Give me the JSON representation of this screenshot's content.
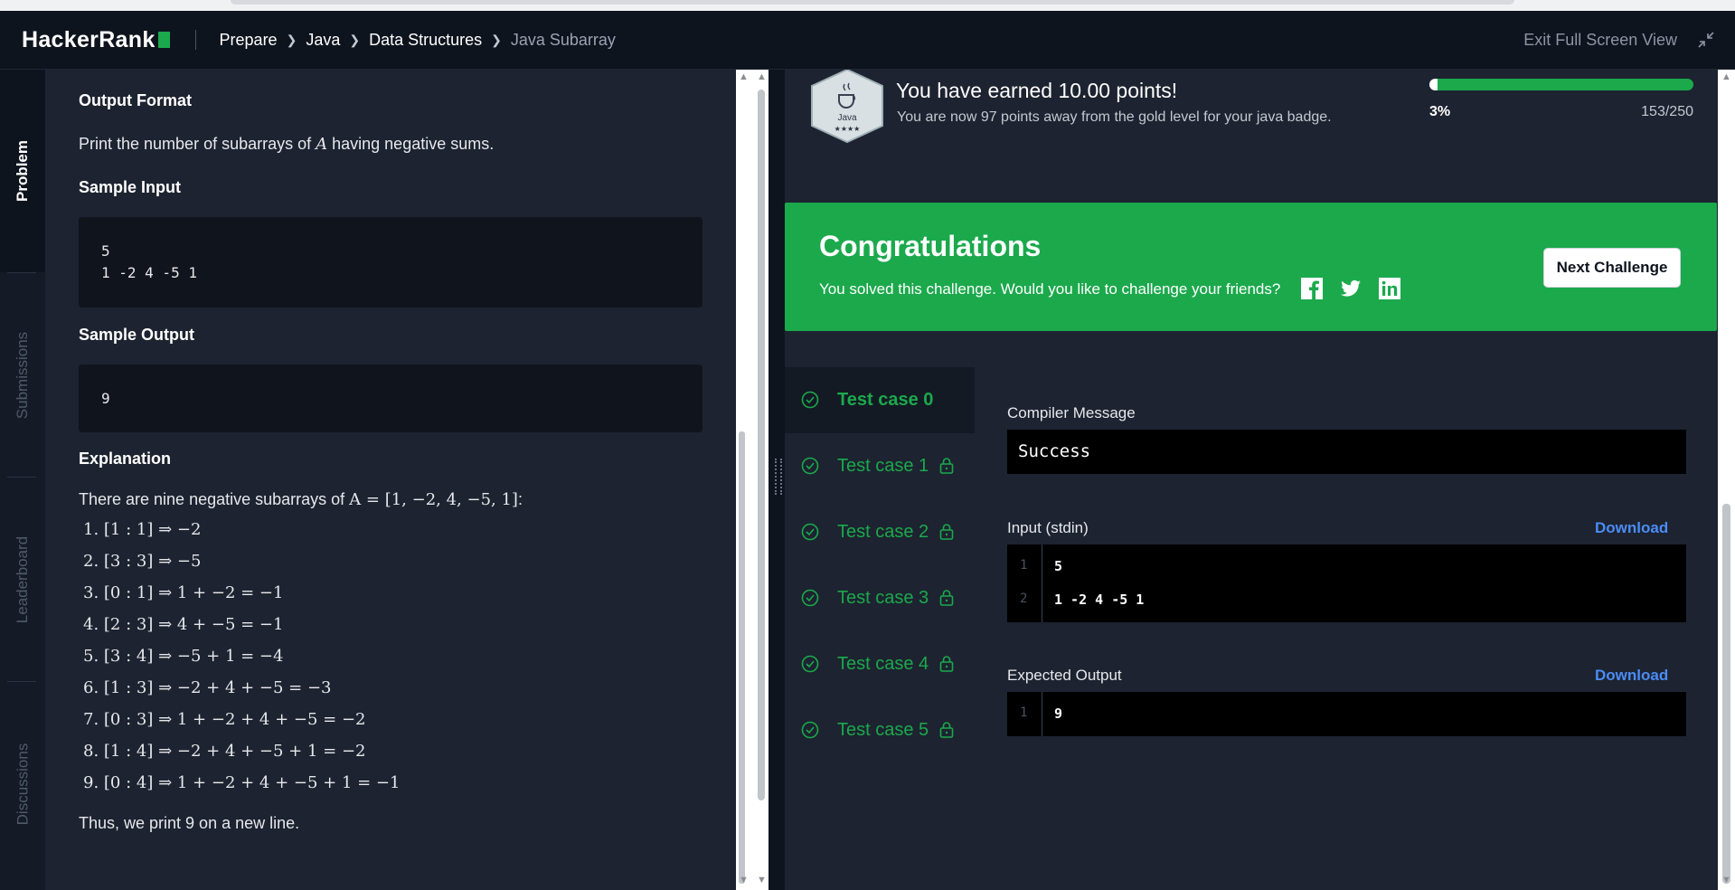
{
  "header": {
    "logo": "HackerRank",
    "breadcrumb": [
      "Prepare",
      "Java",
      "Data Structures"
    ],
    "current": "Java Subarray",
    "exit_label": "Exit Full Screen View"
  },
  "side_tabs": {
    "problem": "Problem",
    "submissions": "Submissions",
    "leaderboard": "Leaderboard",
    "discussions": "Discussions"
  },
  "problem": {
    "output_format_heading": "Output Format",
    "output_format_text_pre": "Print the number of subarrays of ",
    "output_format_var": "A",
    "output_format_text_post": " having negative sums.",
    "sample_input_heading": "Sample Input",
    "sample_input_lines": [
      "5",
      "1 -2 4 -5 1"
    ],
    "sample_output_heading": "Sample Output",
    "sample_output": "9",
    "explanation_heading": "Explanation",
    "explanation_intro_pre": "There are nine negative subarrays of ",
    "explanation_intro_math": "A = [1, −2, 4, −5, 1]",
    "explanation_intro_post": ":",
    "explanation_items": [
      "1. [1 : 1] ⇒ −2",
      "2. [3 : 3] ⇒ −5",
      "3. [0 : 1] ⇒ 1 + −2 = −1",
      "4. [2 : 3] ⇒ 4 + −5 = −1",
      "5. [3 : 4] ⇒ −5 + 1 = −4",
      "6. [1 : 3] ⇒ −2 + 4 + −5 = −3",
      "7. [0 : 3] ⇒ 1 + −2 + 4 + −5 = −2",
      "8. [1 : 4] ⇒ −2 + 4 + −5 + 1 = −2",
      "9. [0 : 4] ⇒ 1 + −2 + 4 + −5 + 1 = −1"
    ],
    "conclusion": "Thus, we print 9 on a new line."
  },
  "result": {
    "badge_name": "Java",
    "badge_stars": "★★★★",
    "earned_title": "You have earned 10.00 points!",
    "earned_sub": "You are now 97 points away from the gold level for your java badge.",
    "progress_fraction": 0.03,
    "progress_percent": "3%",
    "progress_points": "153/250",
    "congrats_title": "Congratulations",
    "congrats_msg": "You solved this challenge. Would you like to challenge your friends?",
    "next_button": "Next Challenge",
    "compiler_label": "Compiler Message",
    "compiler_msg": "Success",
    "input_label": "Input (stdin)",
    "input_lines": [
      "5",
      "1 -2 4 -5 1"
    ],
    "expected_label": "Expected Output",
    "expected_lines": [
      "9"
    ],
    "download_label": "Download",
    "test_cases": [
      "Test case 0",
      "Test case 1",
      "Test case 2",
      "Test case 3",
      "Test case 4",
      "Test case 5"
    ]
  },
  "colors": {
    "green": "#1ba94c",
    "bg": "#1d2330",
    "header_bg": "#0e141e",
    "link": "#4b8cf5"
  }
}
